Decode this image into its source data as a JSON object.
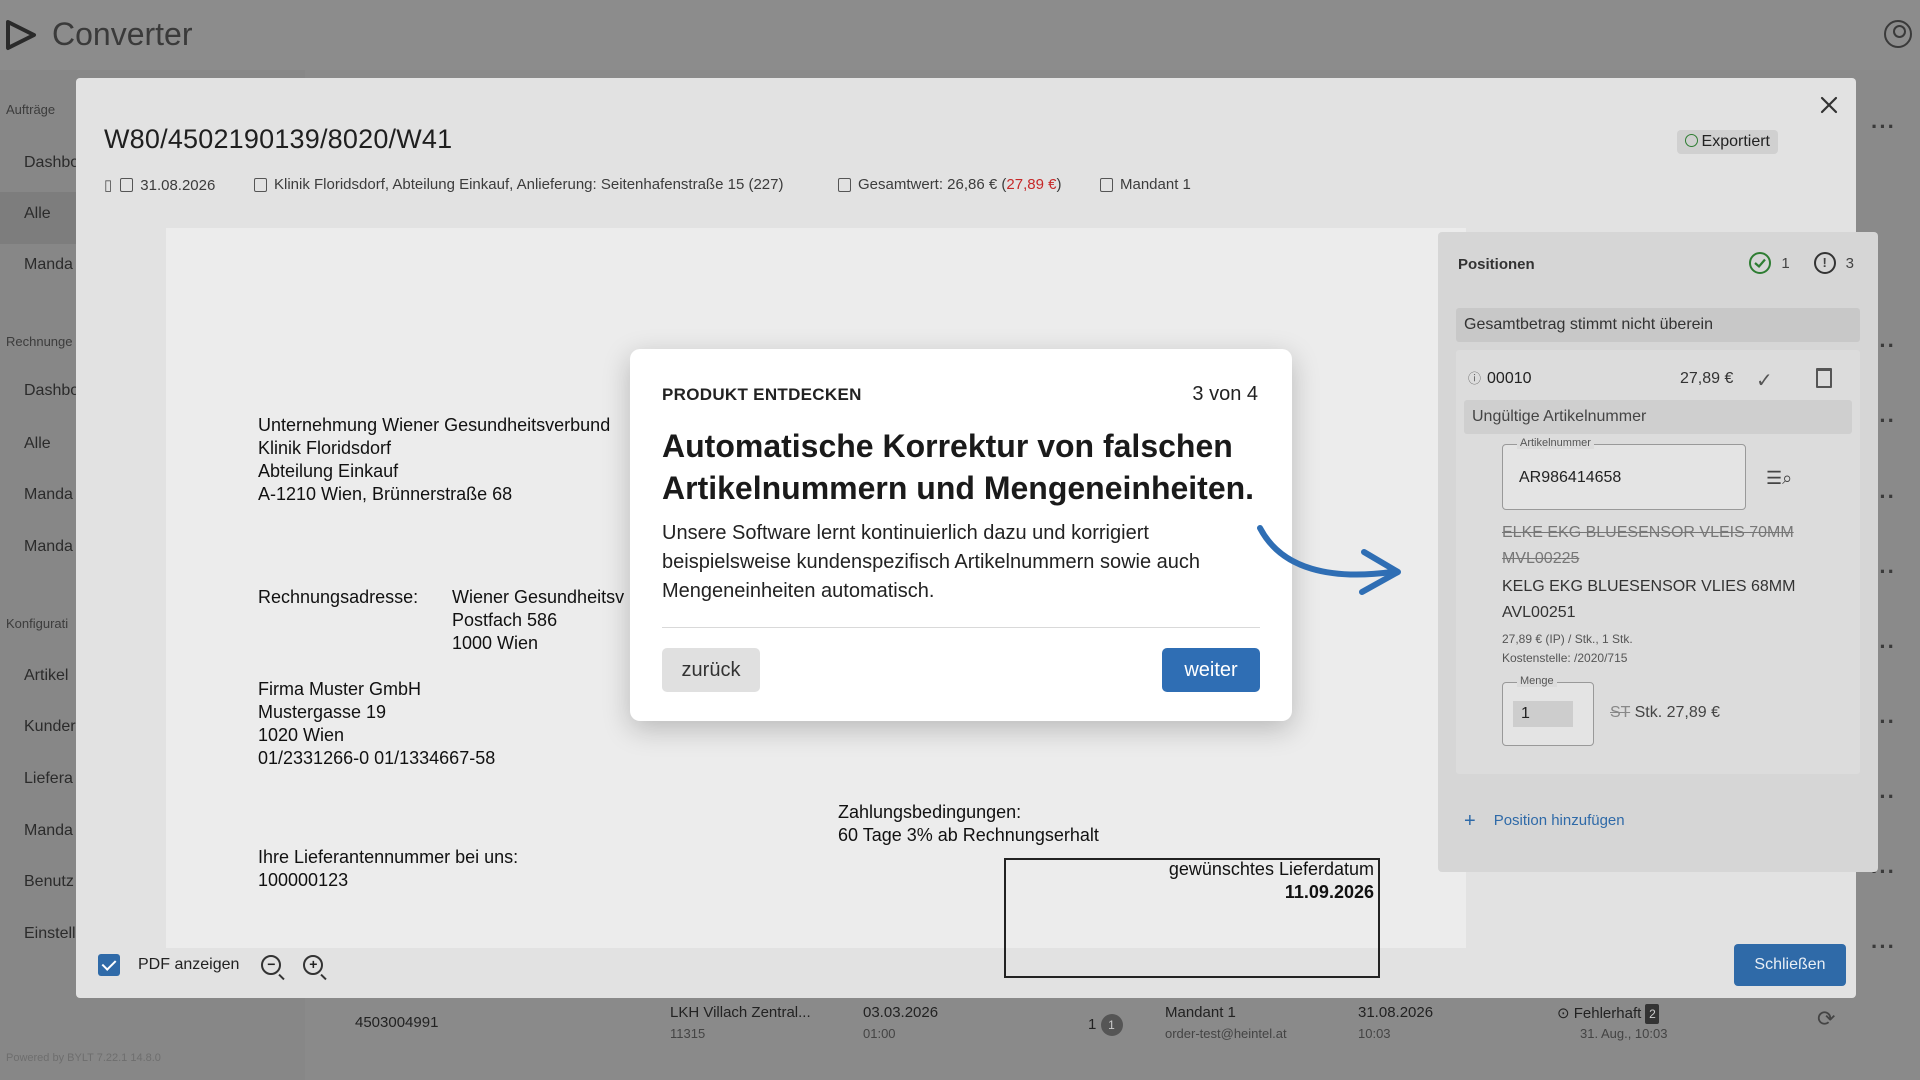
{
  "app": {
    "title": "Converter",
    "sidebar": {
      "sections": [
        {
          "heading": "Aufträge",
          "items": [
            "Dashbo",
            "Alle",
            "Manda"
          ]
        },
        {
          "heading": "Rechnunge",
          "items": [
            "Dashbo",
            "Alle",
            "Manda",
            "Manda"
          ]
        },
        {
          "heading": "Konfigurati",
          "items": [
            "Artikel",
            "Kunder",
            "Liefera",
            "Manda",
            "Benutz",
            "Einstell"
          ]
        }
      ],
      "footer": "Powered by BYLT   7.22.1 14.8.0"
    },
    "row": {
      "order_no": "4503004991",
      "customer": "LKH Villach Zentral...",
      "customer_no": "11315",
      "date": "03.03.2026",
      "time": "01:00",
      "count": "1",
      "count_badge": "1",
      "mandant": "Mandant 1",
      "email": "order-test@heintel.at",
      "date2": "31.08.2026",
      "time2": "10:03",
      "status": "Fehlerhaft",
      "status_badge": "2",
      "status_sub": "31. Aug., 10:03"
    }
  },
  "dialog": {
    "title": "W80/4502190139/8020/W41",
    "export_status": "Exportiert",
    "meta": {
      "date": "31.08.2026",
      "address": "Klinik Floridsdorf, Abteilung Einkauf, Anlieferung: Seitenhafenstraße 15 (227)",
      "total_prefix": "Gesamtwert: 26,86 € (",
      "total_red": "27,89 €",
      "total_suffix": ")",
      "mandant": "Mandant 1"
    },
    "document": {
      "sender": "Unternehmung Wiener Gesundheitsverbund\nKlinik Floridsdorf\nAbteilung Einkauf\nA-1210 Wien, Brünnerstraße 68",
      "billing_label": "Rechnungsadresse:",
      "billing_address": "Wiener Gesundheitsv\nPostfach 586\n1000 Wien",
      "supplier": "Firma Muster GmbH\nMustergasse 19\n1020 Wien\n01/2331266-0 01/1334667-58",
      "supplier_no_label": "Ihre Lieferantennummer bei uns:\n100000123",
      "delivery_label": "gewünschtes Lieferdatum",
      "delivery_date": "11.09.2026",
      "payment": "Zahlungsbedingungen:\n60 Tage 3% ab Rechnungserhalt"
    },
    "positions": {
      "title": "Positionen",
      "ok_count": "1",
      "warn_count": "3",
      "total_warning": "Gesamtbetrag stimmt nicht überein",
      "item": {
        "id": "00010",
        "price": "27,89 €",
        "warning": "Ungültige Artikelnummer",
        "article_label": "Artikelnummer",
        "article_value": "AR986414658",
        "old_name": "ELKE EKG BLUESENSOR VLEIS 70MM",
        "old_code": "MVL00225",
        "new_name": "KELG EKG BLUESENSOR VLIES 68MM",
        "new_code": "AVL00251",
        "detail1": "27,89 € (IP) / Stk., 1 Stk.",
        "detail2": "Kostenstelle: /2020/715",
        "qty_label": "Menge",
        "qty_value": "1",
        "old_unit": "ST",
        "unit_total": "Stk. 27,89 €"
      },
      "add_label": "Position hinzufügen"
    },
    "footer": {
      "pdf_label": "PDF anzeigen",
      "close_label": "Schließen"
    }
  },
  "tour": {
    "eyebrow": "PRODUKT ENTDECKEN",
    "step": "3 von 4",
    "title": "Automatische Korrektur von falschen Artikelnummern und Mengeneinheiten.",
    "body": "Unsere Software lernt kontinuierlich dazu und korrigiert beispielsweise kundenspezifisch Artikelnummern sowie auch Mengeneinheiten automatisch.",
    "back_label": "zurück",
    "next_label": "weiter"
  },
  "colors": {
    "primary": "#2f6eb4",
    "success": "#2e7d32",
    "error": "#c62828",
    "overlay": "#8a8a8a"
  }
}
